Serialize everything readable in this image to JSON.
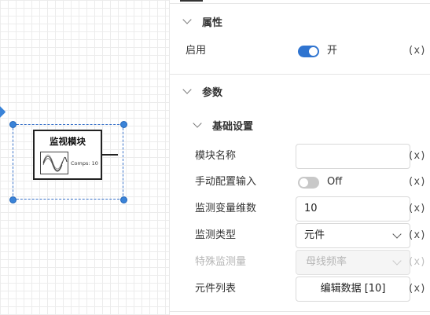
{
  "canvas": {
    "block": {
      "title": "监视模块",
      "comps_label": "Comps: 10",
      "icon": "waveform-icon"
    }
  },
  "panel": {
    "attributes": {
      "title": "属性",
      "enable": {
        "label": "启用",
        "value": "开",
        "state": true,
        "bind": "(x)"
      }
    },
    "parameters": {
      "title": "参数",
      "basic": {
        "title": "基础设置",
        "fields": {
          "module_name": {
            "label": "模块名称",
            "value": "",
            "bind": "(x)"
          },
          "manual_input": {
            "label": "手动配置输入",
            "value": "Off",
            "state": false,
            "bind": "(x)"
          },
          "dimension": {
            "label": "监测变量维数",
            "value": "10",
            "bind": "(x)"
          },
          "monitor_type": {
            "label": "监测类型",
            "value": "元件",
            "bind": "(x)"
          },
          "special_quantity": {
            "label": "特殊监测量",
            "value": "母线频率",
            "bind": "(x)",
            "disabled": true
          },
          "component_list": {
            "label": "元件列表",
            "button_label": "编辑数据 [10]",
            "bind": "(x)"
          }
        }
      }
    }
  },
  "colors": {
    "accent": "#2f74d0",
    "selection": "#3a83d8",
    "toggle_off": "#c8c8c8"
  }
}
